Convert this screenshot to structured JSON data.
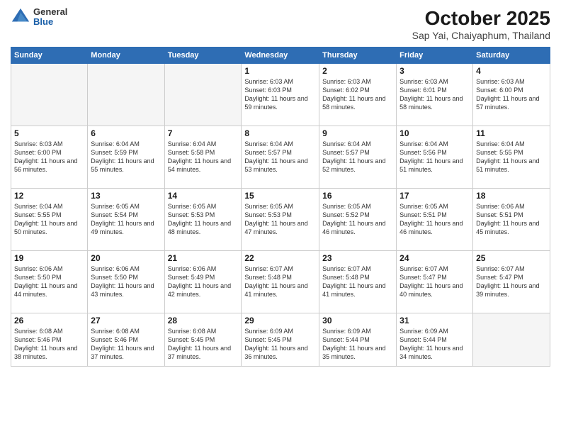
{
  "header": {
    "logo": {
      "line1": "General",
      "line2": "Blue"
    },
    "title": "October 2025",
    "subtitle": "Sap Yai, Chaiyaphum, Thailand"
  },
  "weekdays": [
    "Sunday",
    "Monday",
    "Tuesday",
    "Wednesday",
    "Thursday",
    "Friday",
    "Saturday"
  ],
  "weeks": [
    [
      {
        "day": "",
        "info": ""
      },
      {
        "day": "",
        "info": ""
      },
      {
        "day": "",
        "info": ""
      },
      {
        "day": "1",
        "info": "Sunrise: 6:03 AM\nSunset: 6:03 PM\nDaylight: 11 hours\nand 59 minutes."
      },
      {
        "day": "2",
        "info": "Sunrise: 6:03 AM\nSunset: 6:02 PM\nDaylight: 11 hours\nand 58 minutes."
      },
      {
        "day": "3",
        "info": "Sunrise: 6:03 AM\nSunset: 6:01 PM\nDaylight: 11 hours\nand 58 minutes."
      },
      {
        "day": "4",
        "info": "Sunrise: 6:03 AM\nSunset: 6:00 PM\nDaylight: 11 hours\nand 57 minutes."
      }
    ],
    [
      {
        "day": "5",
        "info": "Sunrise: 6:03 AM\nSunset: 6:00 PM\nDaylight: 11 hours\nand 56 minutes."
      },
      {
        "day": "6",
        "info": "Sunrise: 6:04 AM\nSunset: 5:59 PM\nDaylight: 11 hours\nand 55 minutes."
      },
      {
        "day": "7",
        "info": "Sunrise: 6:04 AM\nSunset: 5:58 PM\nDaylight: 11 hours\nand 54 minutes."
      },
      {
        "day": "8",
        "info": "Sunrise: 6:04 AM\nSunset: 5:57 PM\nDaylight: 11 hours\nand 53 minutes."
      },
      {
        "day": "9",
        "info": "Sunrise: 6:04 AM\nSunset: 5:57 PM\nDaylight: 11 hours\nand 52 minutes."
      },
      {
        "day": "10",
        "info": "Sunrise: 6:04 AM\nSunset: 5:56 PM\nDaylight: 11 hours\nand 51 minutes."
      },
      {
        "day": "11",
        "info": "Sunrise: 6:04 AM\nSunset: 5:55 PM\nDaylight: 11 hours\nand 51 minutes."
      }
    ],
    [
      {
        "day": "12",
        "info": "Sunrise: 6:04 AM\nSunset: 5:55 PM\nDaylight: 11 hours\nand 50 minutes."
      },
      {
        "day": "13",
        "info": "Sunrise: 6:05 AM\nSunset: 5:54 PM\nDaylight: 11 hours\nand 49 minutes."
      },
      {
        "day": "14",
        "info": "Sunrise: 6:05 AM\nSunset: 5:53 PM\nDaylight: 11 hours\nand 48 minutes."
      },
      {
        "day": "15",
        "info": "Sunrise: 6:05 AM\nSunset: 5:53 PM\nDaylight: 11 hours\nand 47 minutes."
      },
      {
        "day": "16",
        "info": "Sunrise: 6:05 AM\nSunset: 5:52 PM\nDaylight: 11 hours\nand 46 minutes."
      },
      {
        "day": "17",
        "info": "Sunrise: 6:05 AM\nSunset: 5:51 PM\nDaylight: 11 hours\nand 46 minutes."
      },
      {
        "day": "18",
        "info": "Sunrise: 6:06 AM\nSunset: 5:51 PM\nDaylight: 11 hours\nand 45 minutes."
      }
    ],
    [
      {
        "day": "19",
        "info": "Sunrise: 6:06 AM\nSunset: 5:50 PM\nDaylight: 11 hours\nand 44 minutes."
      },
      {
        "day": "20",
        "info": "Sunrise: 6:06 AM\nSunset: 5:50 PM\nDaylight: 11 hours\nand 43 minutes."
      },
      {
        "day": "21",
        "info": "Sunrise: 6:06 AM\nSunset: 5:49 PM\nDaylight: 11 hours\nand 42 minutes."
      },
      {
        "day": "22",
        "info": "Sunrise: 6:07 AM\nSunset: 5:48 PM\nDaylight: 11 hours\nand 41 minutes."
      },
      {
        "day": "23",
        "info": "Sunrise: 6:07 AM\nSunset: 5:48 PM\nDaylight: 11 hours\nand 41 minutes."
      },
      {
        "day": "24",
        "info": "Sunrise: 6:07 AM\nSunset: 5:47 PM\nDaylight: 11 hours\nand 40 minutes."
      },
      {
        "day": "25",
        "info": "Sunrise: 6:07 AM\nSunset: 5:47 PM\nDaylight: 11 hours\nand 39 minutes."
      }
    ],
    [
      {
        "day": "26",
        "info": "Sunrise: 6:08 AM\nSunset: 5:46 PM\nDaylight: 11 hours\nand 38 minutes."
      },
      {
        "day": "27",
        "info": "Sunrise: 6:08 AM\nSunset: 5:46 PM\nDaylight: 11 hours\nand 37 minutes."
      },
      {
        "day": "28",
        "info": "Sunrise: 6:08 AM\nSunset: 5:45 PM\nDaylight: 11 hours\nand 37 minutes."
      },
      {
        "day": "29",
        "info": "Sunrise: 6:09 AM\nSunset: 5:45 PM\nDaylight: 11 hours\nand 36 minutes."
      },
      {
        "day": "30",
        "info": "Sunrise: 6:09 AM\nSunset: 5:44 PM\nDaylight: 11 hours\nand 35 minutes."
      },
      {
        "day": "31",
        "info": "Sunrise: 6:09 AM\nSunset: 5:44 PM\nDaylight: 11 hours\nand 34 minutes."
      },
      {
        "day": "",
        "info": ""
      }
    ]
  ]
}
